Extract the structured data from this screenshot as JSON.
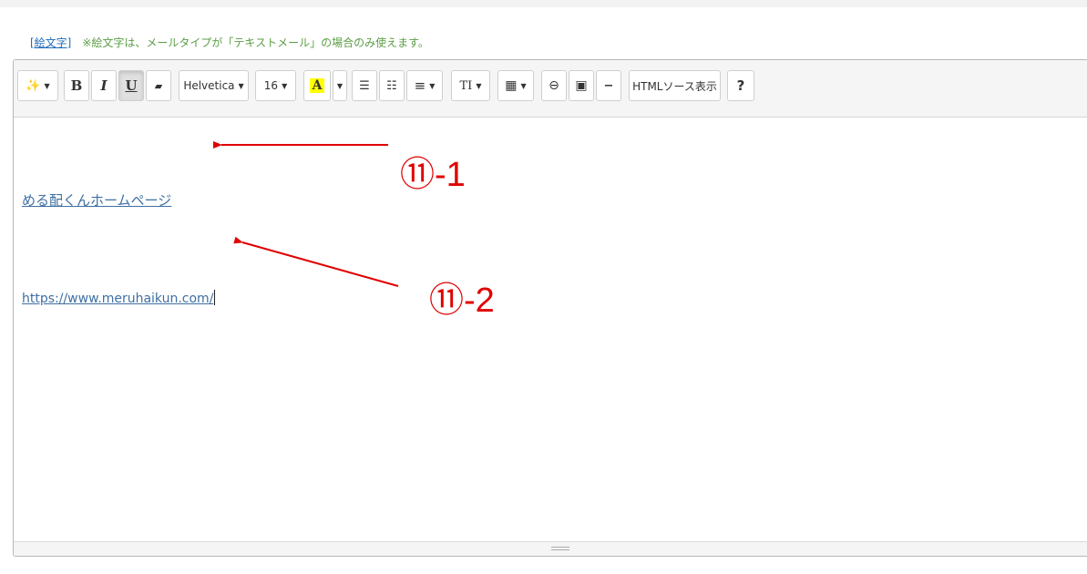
{
  "emoji_bar": {
    "link_label": "[絵文字]",
    "note": "※絵文字は、メールタイプが「テキストメール」の場合のみ使えます。"
  },
  "toolbar": {
    "magic_label": "✨",
    "bold_label": "B",
    "italic_label": "I",
    "underline_label": "U",
    "eraser_label": "▰",
    "font_family": "Helvetica",
    "font_size": "16",
    "color_label": "A",
    "ul_label": "☰",
    "ol_label": "☷",
    "align_label": "≡",
    "height_label": "TI",
    "table_label": "▦",
    "link_label": "⊖",
    "image_label": "▣",
    "hr_label": "−",
    "source_label": "HTMLソース表示",
    "help_label": "?"
  },
  "content": {
    "link1_text": "める配くんホームページ",
    "link2_text": "https://www.meruhaikun.com/"
  },
  "annotations": {
    "label1": "⑪-1",
    "label2": "⑪-2"
  },
  "colors": {
    "annotation": "#e00000",
    "link": "#3f6fa3",
    "note": "#5b9e45"
  }
}
